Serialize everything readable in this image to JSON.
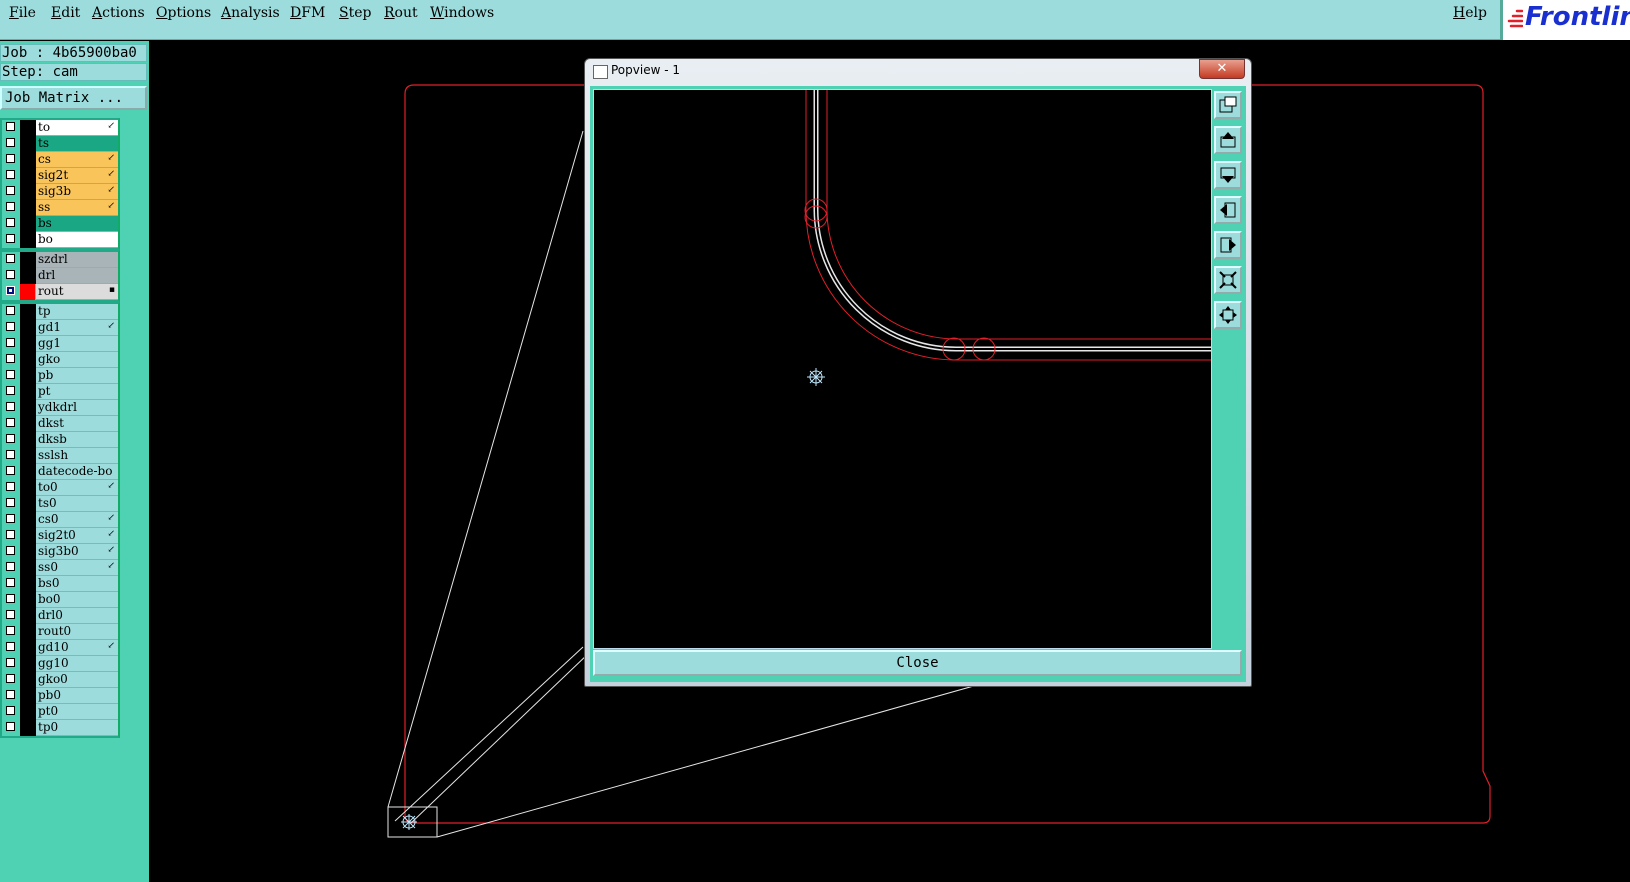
{
  "menubar": {
    "items": [
      "File",
      "Edit",
      "Actions",
      "Options",
      "Analysis",
      "DFM",
      "Step",
      "Rout",
      "Windows"
    ],
    "help": "Help",
    "logo": "Frontline"
  },
  "left_panel": {
    "job": "Job : 4b65900ba0",
    "step": "Step: cam",
    "job_matrix": "Job Matrix ...",
    "groups": [
      [
        {
          "name": "to",
          "color": "#ffffff",
          "mark": "↙"
        },
        {
          "name": "ts",
          "color": "#1aa784",
          "mark": ""
        },
        {
          "name": "cs",
          "color": "#f9c45a",
          "mark": "↙"
        },
        {
          "name": "sig2t",
          "color": "#f9c45a",
          "mark": "↙"
        },
        {
          "name": "sig3b",
          "color": "#f9c45a",
          "mark": "↙"
        },
        {
          "name": "ss",
          "color": "#f9c45a",
          "mark": "↙"
        },
        {
          "name": "bs",
          "color": "#1aa784",
          "mark": ""
        },
        {
          "name": "bo",
          "color": "#ffffff",
          "mark": ""
        }
      ],
      [
        {
          "name": "szdrl",
          "color": "#a9b4b8",
          "mark": ""
        },
        {
          "name": "drl",
          "color": "#a9b4b8",
          "mark": ""
        },
        {
          "name": "rout",
          "color": "#dcdcdc",
          "mark": "▪",
          "active": true
        }
      ],
      [
        {
          "name": "tp",
          "color": "#9ddcdc",
          "mark": ""
        },
        {
          "name": "gd1",
          "color": "#9ddcdc",
          "mark": "↙"
        },
        {
          "name": "gg1",
          "color": "#9ddcdc",
          "mark": ""
        },
        {
          "name": "gko",
          "color": "#9ddcdc",
          "mark": ""
        },
        {
          "name": "pb",
          "color": "#9ddcdc",
          "mark": ""
        },
        {
          "name": "pt",
          "color": "#9ddcdc",
          "mark": ""
        },
        {
          "name": "ydkdrl",
          "color": "#9ddcdc",
          "mark": ""
        },
        {
          "name": "dkst",
          "color": "#9ddcdc",
          "mark": ""
        },
        {
          "name": "dksb",
          "color": "#9ddcdc",
          "mark": ""
        },
        {
          "name": "sslsh",
          "color": "#9ddcdc",
          "mark": ""
        },
        {
          "name": "datecode-bo",
          "color": "#9ddcdc",
          "mark": ""
        },
        {
          "name": "to0",
          "color": "#9ddcdc",
          "mark": "↙"
        },
        {
          "name": "ts0",
          "color": "#9ddcdc",
          "mark": ""
        },
        {
          "name": "cs0",
          "color": "#9ddcdc",
          "mark": "↙"
        },
        {
          "name": "sig2t0",
          "color": "#9ddcdc",
          "mark": "↙"
        },
        {
          "name": "sig3b0",
          "color": "#9ddcdc",
          "mark": "↙"
        },
        {
          "name": "ss0",
          "color": "#9ddcdc",
          "mark": "↙"
        },
        {
          "name": "bs0",
          "color": "#9ddcdc",
          "mark": ""
        },
        {
          "name": "bo0",
          "color": "#9ddcdc",
          "mark": ""
        },
        {
          "name": "drl0",
          "color": "#9ddcdc",
          "mark": ""
        },
        {
          "name": "rout0",
          "color": "#9ddcdc",
          "mark": ""
        },
        {
          "name": "gd10",
          "color": "#9ddcdc",
          "mark": "↙"
        },
        {
          "name": "gg10",
          "color": "#9ddcdc",
          "mark": ""
        },
        {
          "name": "gko0",
          "color": "#9ddcdc",
          "mark": ""
        },
        {
          "name": "pb0",
          "color": "#9ddcdc",
          "mark": ""
        },
        {
          "name": "pt0",
          "color": "#9ddcdc",
          "mark": ""
        },
        {
          "name": "tp0",
          "color": "#9ddcdc",
          "mark": ""
        }
      ]
    ]
  },
  "popview": {
    "title": "Popview - 1",
    "close_x": "✕",
    "close_button": "Close"
  },
  "colors": {
    "menubar": "#9ddcdc",
    "panel": "#4fd1b4",
    "outline": "#e0202a",
    "trace": "#e6e6e6"
  }
}
